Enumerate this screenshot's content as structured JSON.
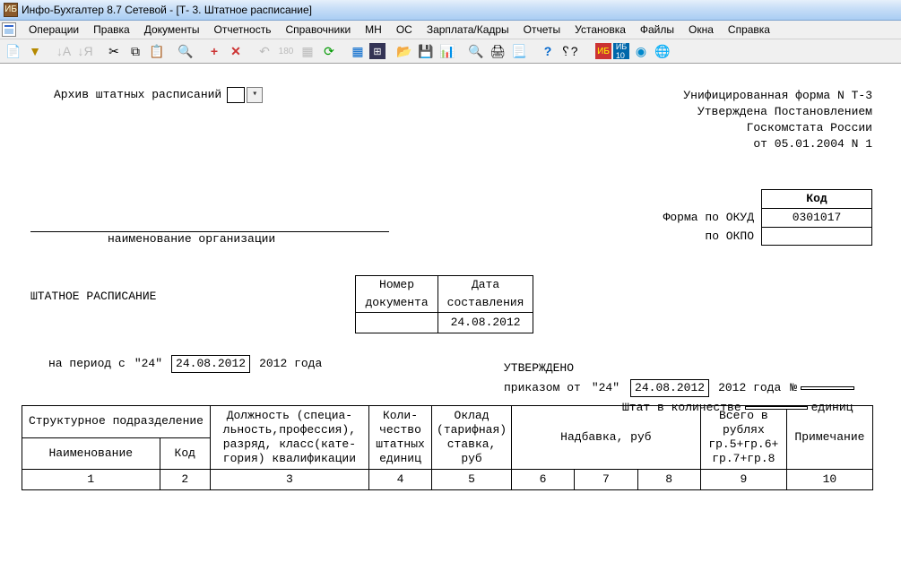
{
  "window": {
    "title": "Инфо-Бухгалтер 8.7 Сетевой - [Т- 3. Штатное расписание]"
  },
  "menu": {
    "items": [
      "Операции",
      "Правка",
      "Документы",
      "Отчетность",
      "Справочники",
      "МН",
      "ОС",
      "Зарплата/Кадры",
      "Отчеты",
      "Установка",
      "Файлы",
      "Окна",
      "Справка"
    ]
  },
  "archive": {
    "label": "Архив штатных расписаний"
  },
  "form_header": {
    "line1": "Унифицированная форма N Т-3",
    "line2": "Утверждена Постановлением",
    "line3": "Госкомстата России",
    "line4": "от 05.01.2004 N 1"
  },
  "codes": {
    "kod_header": "Код",
    "okud_label": "Форма по ОКУД",
    "okud_value": "0301017",
    "okpo_label": "по ОКПО",
    "okpo_value": ""
  },
  "org": {
    "caption": "наименование организации"
  },
  "title": "ШТАТНОЕ РАСПИСАНИЕ",
  "docnum": {
    "num_h1": "Номер",
    "num_h2": "документа",
    "date_h1": "Дата",
    "date_h2": "составления",
    "num_value": "",
    "date_value": "24.08.2012"
  },
  "period": {
    "prefix": "на  период с",
    "day": "\"24\"",
    "date": "24.08.2012",
    "year_text": "2012 года"
  },
  "approved": {
    "title": "УТВЕРЖДЕНО",
    "order_prefix": "приказом от",
    "order_day": "\"24\"",
    "order_date": "24.08.2012",
    "order_year": "2012 года",
    "num_sym": "№",
    "num_value": "",
    "staff_prefix": "Штат в количестве",
    "staff_value": "",
    "staff_suffix": "единиц"
  },
  "table": {
    "h_struct": "Структурное подразделение",
    "h_name": "Наименование",
    "h_code": "Код",
    "h_position": "Должность (специа-\nльность,профессия),\nразряд, класс(кате-\nгория) квалификации",
    "h_qty": "Коли-\nчество\nштатных\nединиц",
    "h_salary": "Оклад\n(тарифная)\nставка,\nруб",
    "h_allow": "Надбавка, руб",
    "h_total": "Всего в\nрублях\nгр.5+гр.6+\nгр.7+гр.8",
    "h_note": "Примечание",
    "nums": [
      "1",
      "2",
      "3",
      "4",
      "5",
      "6",
      "7",
      "8",
      "9",
      "10"
    ]
  }
}
